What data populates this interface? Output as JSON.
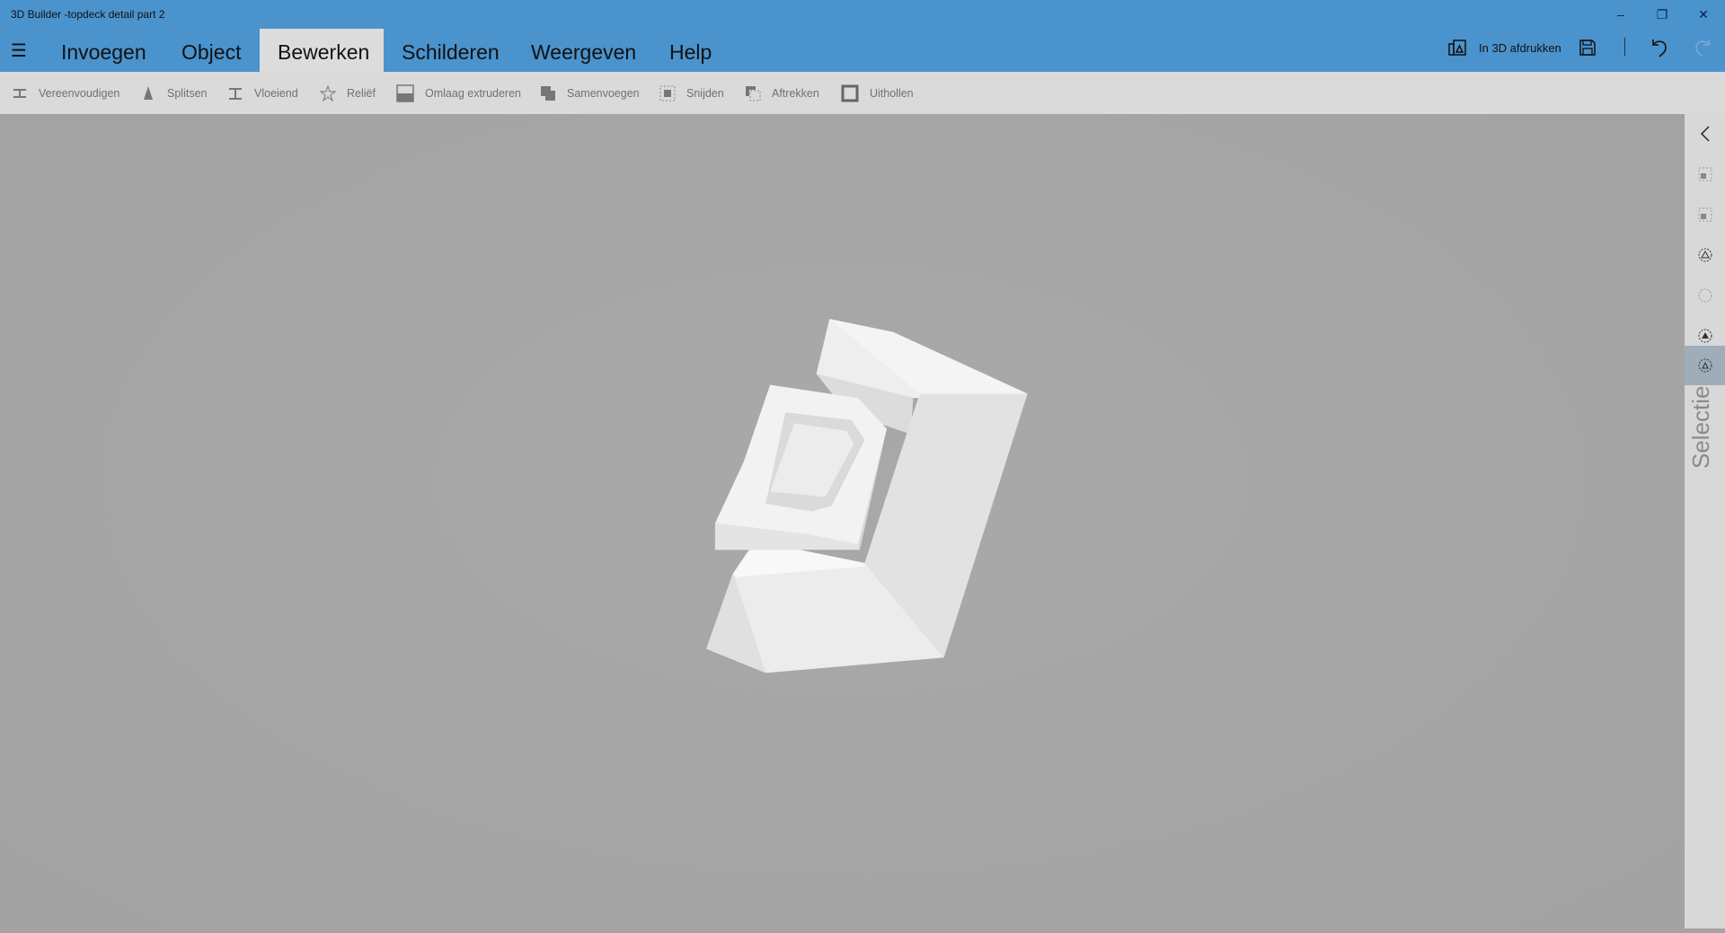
{
  "window": {
    "title": "3D Builder -topdeck detail part 2",
    "minimize": "–",
    "restore": "❐",
    "close": "✕"
  },
  "tabs": [
    {
      "label": "Invoegen"
    },
    {
      "label": "Object"
    },
    {
      "label": "Bewerken",
      "active": true
    },
    {
      "label": "Schilderen"
    },
    {
      "label": "Weergeven"
    },
    {
      "label": "Help"
    }
  ],
  "header_actions": {
    "print_label": "In 3D afdrukken"
  },
  "toolbar": [
    {
      "label": "Vereenvoudigen",
      "icon": "simplify-icon"
    },
    {
      "label": "Splitsen",
      "icon": "split-icon"
    },
    {
      "label": "Vloeiend",
      "icon": "smooth-icon"
    },
    {
      "label": "Reliëf",
      "icon": "emboss-icon"
    },
    {
      "label": "Omlaag extruderen",
      "icon": "extrude-down-icon"
    },
    {
      "label": "Samenvoegen",
      "icon": "merge-icon"
    },
    {
      "label": "Snijden",
      "icon": "intersect-icon"
    },
    {
      "label": "Aftrekken",
      "icon": "subtract-icon"
    },
    {
      "label": "Uithollen",
      "icon": "hollow-icon"
    }
  ],
  "side_panel": {
    "label": "Selectie"
  },
  "colors": {
    "accent": "#4a93cd",
    "toolbar": "#dadada",
    "viewport": "#a4a4a4",
    "selected": "#9eadb7"
  }
}
